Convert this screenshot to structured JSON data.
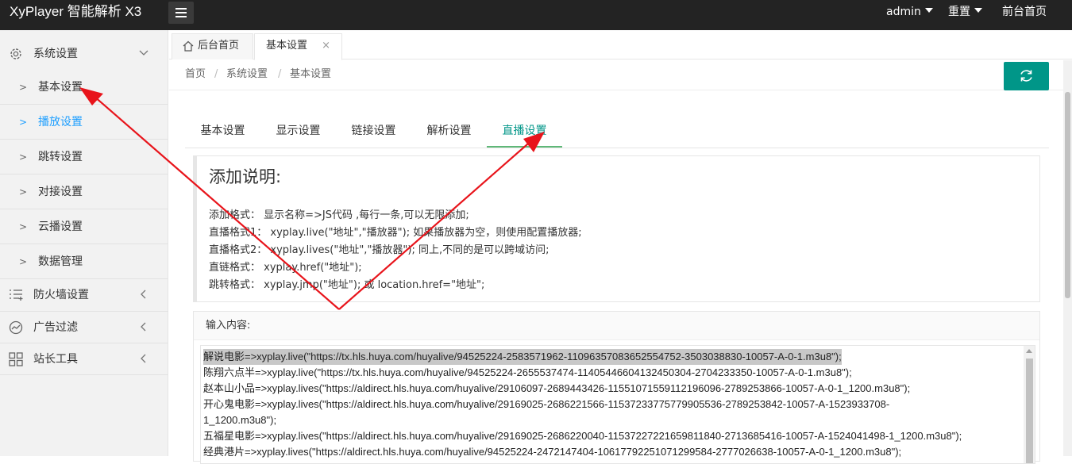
{
  "header": {
    "app_title": "XyPlayer 智能解析 X3",
    "user": "admin",
    "reset": "重置",
    "front_home": "前台首页"
  },
  "sidebar": {
    "groups": [
      {
        "label": "系统设置",
        "icon": "gear-icon"
      },
      {
        "label": "防火墙设置",
        "icon": "list-icon"
      },
      {
        "label": "广告过滤",
        "icon": "dashboard-icon"
      },
      {
        "label": "站长工具",
        "icon": "grid-icon"
      }
    ],
    "items": [
      {
        "label": "基本设置"
      },
      {
        "label": "播放设置",
        "active": true
      },
      {
        "label": "跳转设置"
      },
      {
        "label": "对接设置"
      },
      {
        "label": "云播设置"
      },
      {
        "label": "数据管理"
      }
    ]
  },
  "tabs": [
    {
      "label": "后台首页",
      "icon": "home-icon"
    },
    {
      "label": "基本设置",
      "close": "×"
    }
  ],
  "breadcrumb": [
    "首页",
    "系统设置",
    "基本设置"
  ],
  "inner_tabs": [
    "基本设置",
    "显示设置",
    "链接设置",
    "解析设置",
    "直播设置"
  ],
  "description": {
    "title": "添加说明:",
    "lines": [
      "添加格式： 显示名称=>JS代码 ,每行一条,可以无限添加;",
      "直播格式1： xyplay.live(\"地址\",\"播放器\"); 如果播放器为空，则使用配置播放器;",
      "直播格式2： xyplay.lives(\"地址\",\"播放器\"); 同上,不同的是可以跨域访问;",
      "直链格式： xyplay.href(\"地址\");",
      "跳转格式： xyplay.jmp(\"地址\"); 或 location.href=\"地址\";"
    ]
  },
  "input": {
    "label": "输入内容:",
    "lines": [
      "解说电影=>xyplay.live(\"https://tx.hls.huya.com/huyalive/94525224-2583571962-11096357083652554752-3503038830-10057-A-0-1.m3u8\");",
      "陈翔六点半=>xyplay.live(\"https://tx.hls.huya.com/huyalive/94525224-2655537474-11405446604132450304-2704233350-10057-A-0-1.m3u8\");",
      "赵本山小品=>xyplay.lives(\"https://aldirect.hls.huya.com/huyalive/29106097-2689443426-11551071559112196096-2789253866-10057-A-0-1_1200.m3u8\");",
      "开心鬼电影=>xyplay.lives(\"https://aldirect.hls.huya.com/huyalive/29169025-2686221566-11537233775779905536-2789253842-10057-A-1523933708-",
      "1_1200.m3u8\");",
      "五福星电影=>xyplay.lives(\"https://aldirect.hls.huya.com/huyalive/29169025-2686220040-11537227221659811840-2713685416-10057-A-1524041498-1_1200.m3u8\");",
      "经典港片=>xyplay.lives(\"https://aldirect.hls.huya.com/huyalive/94525224-2472147404-10617792251071299584-2777026638-10057-A-0-1_1200.m3u8\");"
    ]
  },
  "colors": {
    "accent": "#009688",
    "active_link": "#1e9fff",
    "annotation_arrow": "#e8141b"
  }
}
